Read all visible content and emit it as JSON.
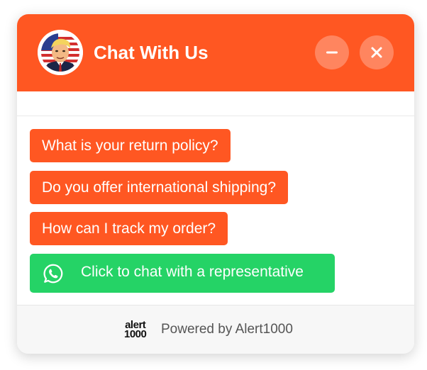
{
  "header": {
    "title": "Chat With Us",
    "avatar": "president-caricature-avatar",
    "minimize_icon": "minus-icon",
    "close_icon": "close-icon",
    "background": "#ff5722"
  },
  "options": [
    {
      "label": "What is your return policy?"
    },
    {
      "label": "Do you offer international shipping?"
    },
    {
      "label": "How can I track my order?"
    }
  ],
  "whatsapp": {
    "label": "Click to chat with a representative",
    "icon": "whatsapp-icon",
    "color": "#25d366"
  },
  "footer": {
    "logo_line1": "alert",
    "logo_line2": "1000",
    "powered_text": "Powered by Alert1000"
  }
}
